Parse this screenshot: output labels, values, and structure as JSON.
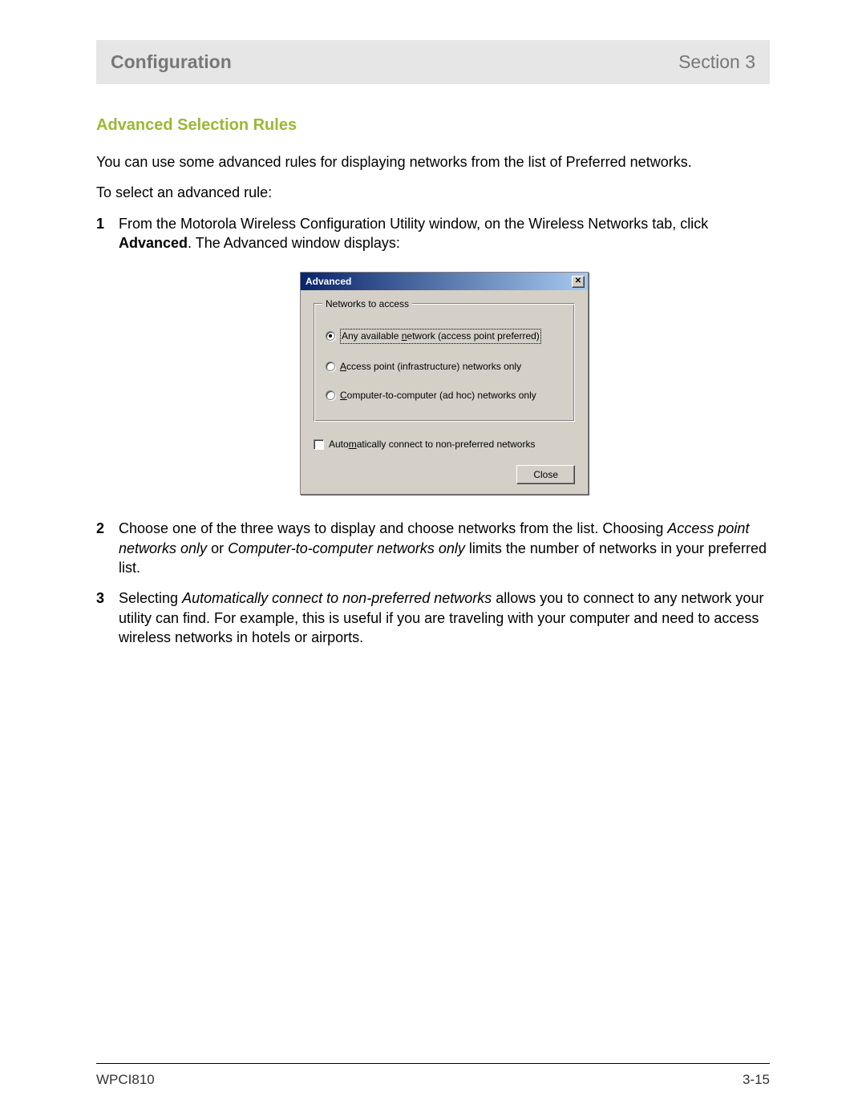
{
  "header": {
    "title": "Configuration",
    "section": "Section 3"
  },
  "subheading": "Advanced Selection Rules",
  "intro1": "You can use some advanced rules for displaying networks from the list of Preferred networks.",
  "intro2": "To select an advanced rule:",
  "step1_a": "From the Motorola Wireless Configuration Utility window, on the Wireless Networks tab, click ",
  "step1_b": "Advanced",
  "step1_c": ". The Advanced window displays:",
  "dialog": {
    "title": "Advanced",
    "group_legend": "Networks to access",
    "opt1_pre": "Any available ",
    "opt1_u": "n",
    "opt1_post": "etwork (access point preferred)",
    "opt2_u": "A",
    "opt2_post": "ccess point (infrastructure) networks only",
    "opt3_u": "C",
    "opt3_post": "omputer-to-computer (ad hoc) networks only",
    "check_pre": "Auto",
    "check_u": "m",
    "check_post": "atically connect to non-preferred networks",
    "close": "Close"
  },
  "step2_a": "Choose one of the three ways to display and choose networks from the list. Choosing ",
  "step2_i1": "Access point networks only",
  "step2_b": " or ",
  "step2_i2": "Computer-to-computer networks only",
  "step2_c": " limits the number of networks in your preferred list.",
  "step3_a": "Selecting ",
  "step3_i": "Automatically connect to non-preferred networks",
  "step3_b": " allows you to connect to any network your utility can find. For example, this is useful if you are traveling with your computer and need to access wireless networks in hotels or airports.",
  "footer": {
    "model": "WPCI810",
    "page": "3-15"
  }
}
